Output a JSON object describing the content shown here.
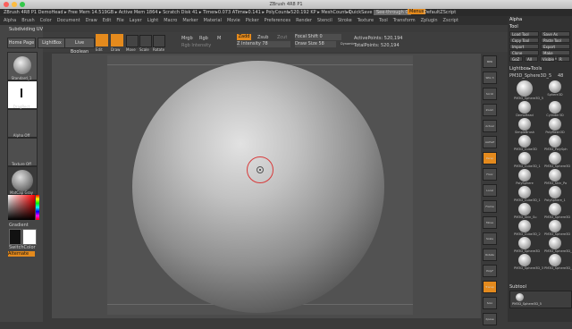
{
  "window": {
    "title": "ZBrush 4R8 P1"
  },
  "status_bar": {
    "left": "ZBrush 4R8 P1 DemoHead  ▸ Free Mem 14.519GB ▸ Active Mem 1864 ▸ Scratch Disk 41 ▸ Timer▸0.073 ATime▸0.141 ▸ PolyCount▸520.192 KP ▸ MeshCount▸1",
    "quicksave": "QuickSave",
    "seethrough": "See-through 0",
    "menus_btn": "Menus",
    "script": "DefaultZScript"
  },
  "menu": {
    "items": [
      "Alpha",
      "Brush",
      "Color",
      "Document",
      "Draw",
      "Edit",
      "File",
      "Layer",
      "Light",
      "Macro",
      "Marker",
      "Material",
      "Movie",
      "Picker",
      "Preferences",
      "Render",
      "Stencil",
      "Stroke",
      "Texture",
      "Tool",
      "Transform",
      "Zplugin",
      "Zscript"
    ]
  },
  "left_panel": {
    "label_top": "Subdividing UV",
    "tiles": [
      {
        "label": "Standard_1"
      },
      {
        "label": "DragRect"
      },
      {
        "label": "Alpha Off"
      },
      {
        "label": "Texture Off"
      },
      {
        "label": "MatCap Gray"
      }
    ],
    "gradient_label": "Gradient",
    "switch_label": "SwitchColor",
    "alternate_label": "Alternate"
  },
  "shelf": {
    "home": "Home Page",
    "lightbox": "LightBox",
    "live_boolean": "Live Boolean",
    "tools": [
      "Edit",
      "Draw",
      "Move",
      "Scale",
      "Rotate"
    ],
    "mrgb": "Mrgb",
    "rgb": "Rgb",
    "m": "M",
    "rgb_intensity": "Rgb Intensity",
    "zadd": "Zadd",
    "zsub": "Zsub",
    "zcut": "Zcut",
    "z_intensity": "Z Intensity 78",
    "focal_shift": "Focal Shift 0",
    "draw_size": "Draw Size 58",
    "dynamic": "Dynamic",
    "active_points": "ActivePoints: 520,194",
    "total_points": "TotalPoints: 520,194"
  },
  "right_strip": {
    "buttons": [
      "BPR",
      "SPix 3",
      "Scroll",
      "Zoom",
      "Actual",
      "AAHalf",
      "Persp",
      "Floor",
      "Local",
      "Frame",
      "Move",
      "Scale",
      "Rotate",
      "PolyF",
      "Transp",
      "Solo",
      "Xpose"
    ]
  },
  "right_panel": {
    "alpha_header": "Alpha",
    "tool_header": "Tool",
    "buttons": [
      [
        "Load Tool",
        "Save As"
      ],
      [
        "Copy Tool",
        "Paste Tool"
      ],
      [
        "Import",
        "Export"
      ],
      [
        "Clone",
        "Make PolyMesh3D"
      ],
      [
        "GoZ",
        "All",
        "Visible",
        "R"
      ]
    ],
    "lightbox_tools": "Lightbox▸Tools",
    "current_tool": "PM3D_Sphere3D_5",
    "current_count": "48",
    "thumbs": [
      "PM3D_Sphere3D_5",
      "Sphere3D",
      "DemoHead",
      "Cylinder3D",
      "SimpleBrush",
      "PolyMesh3D",
      "PM3D_Cube3D",
      "PM3D_PolySph",
      "PM3D_Cube3D_1",
      "PM3D_Sphere3D",
      "PolySphere",
      "PM3D_Skin_Po",
      "PM3D_Cube3D_1",
      "PolySphere_1",
      "PM3D_Skin_Su",
      "PM3D_Sphere3D",
      "PM3D_Cube3D_2",
      "PM3D_Sphere3D",
      "PM3D_Sphere3D",
      "PM3D_Sphere3D_2",
      "PM3D_Sphere3D_3",
      "PM3D_Sphere3D_4"
    ],
    "subtool_header": "Subtool",
    "subtool_item": "PM3D_Sphere3D_5"
  },
  "colors": {
    "accent": "#e48a1d",
    "background": "#3b3b3b"
  }
}
